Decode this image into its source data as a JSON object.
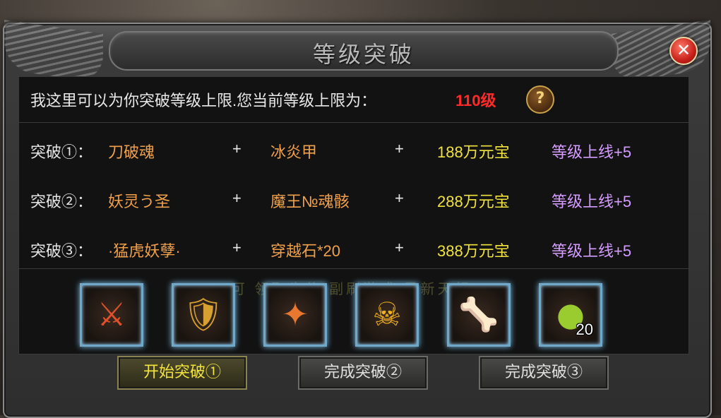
{
  "window": {
    "title": "等级突破"
  },
  "info": {
    "text": "我这里可以为你突破等级上限.您当前等级上限为：",
    "level": "110级"
  },
  "rows": [
    {
      "label": "突破①：",
      "item1": "刀破魂",
      "plus1": "+",
      "item2": "冰炎甲",
      "plus2": "+",
      "cost": "188万元宝",
      "reward": "等级上线+5"
    },
    {
      "label": "突破②：",
      "item1": "妖灵う圣",
      "plus1": "+",
      "item2": "魔王№魂骸",
      "plus2": "+",
      "cost": "288万元宝",
      "reward": "等级上线+5"
    },
    {
      "label": "突破③：",
      "item1": "·猛虎妖孽·",
      "plus1": "+",
      "item2": "穿越石*20",
      "plus2": "+",
      "cost": "388万元宝",
      "reward": "等级上线+5"
    }
  ],
  "faint_text": "可    领取肯悠   副刷游戏   录新天领",
  "slots": [
    {
      "icon": "blade-icon",
      "glyph": "⚔",
      "count": ""
    },
    {
      "icon": "armor-icon",
      "glyph": "🛡",
      "count": ""
    },
    {
      "icon": "claw-icon",
      "glyph": "✦",
      "count": ""
    },
    {
      "icon": "skeleton-icon",
      "glyph": "☠",
      "count": ""
    },
    {
      "icon": "bone-icon",
      "glyph": "🦴",
      "count": ""
    },
    {
      "icon": "stone-icon",
      "glyph": "●",
      "count": "20"
    }
  ],
  "buttons": {
    "start1": "开始突破①",
    "finish2": "完成突破②",
    "finish3": "完成突破③"
  },
  "colors": {
    "level": "#ff2a2a",
    "item": "#f0a04a",
    "cost": "#f0e23a",
    "reward": "#d49cff",
    "slot_glow": "#7fc6ee"
  }
}
